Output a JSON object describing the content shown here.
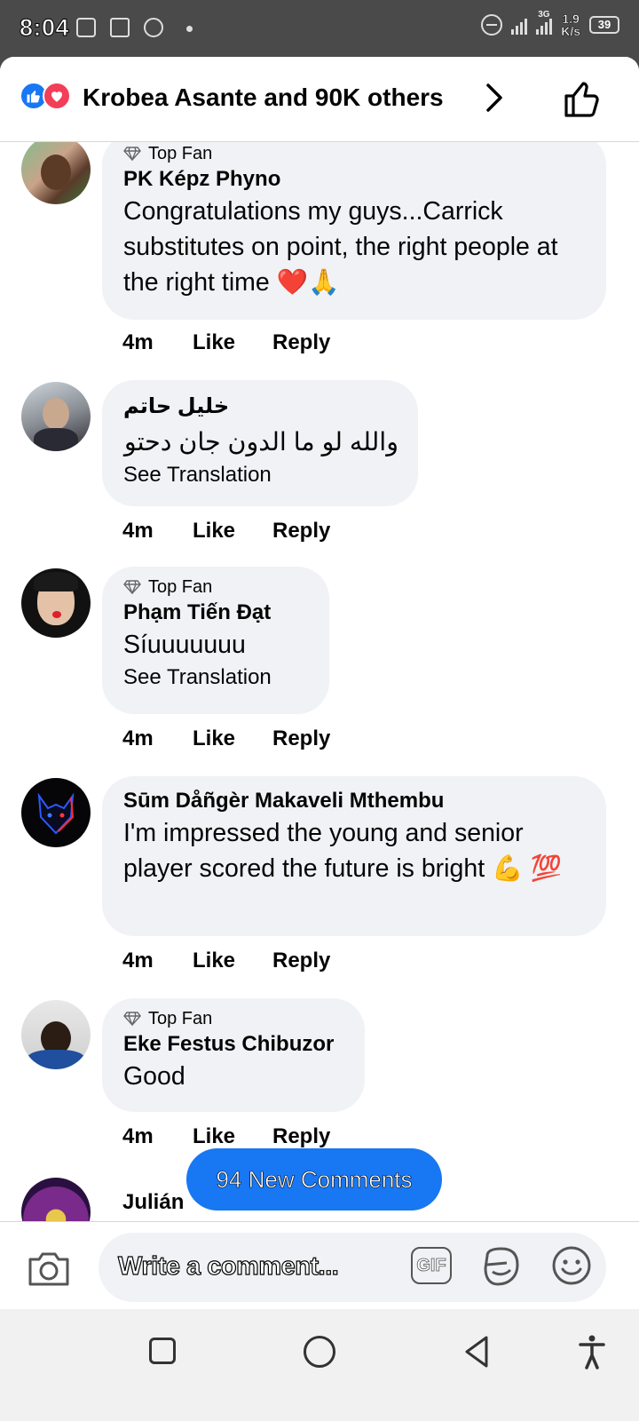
{
  "status_bar": {
    "time": "8:04",
    "network": "3G",
    "speed_value": "1.9",
    "speed_unit": "K/s",
    "battery": "39"
  },
  "header": {
    "reactions_text": "Krobea Asante and 90K others"
  },
  "comments": [
    {
      "badge": "Top Fan",
      "author": "PK Képz Phyno",
      "text": "Congratulations my guys...Carrick substitutes on point, the right people at the right time ❤️🙏",
      "time": "4m",
      "like": "Like",
      "reply": "Reply"
    },
    {
      "author": "خليل حاتم",
      "text": "والله لو ما الدون جان دحتو",
      "see_translation": "See Translation",
      "time": "4m",
      "like": "Like",
      "reply": "Reply"
    },
    {
      "badge": "Top Fan",
      "author": "Phạm Tiến Đạt",
      "text": "Síuuuuuuu",
      "see_translation": "See Translation",
      "time": "4m",
      "like": "Like",
      "reply": "Reply"
    },
    {
      "author": "Sūm Dåñgèr Makaveli Mthembu",
      "text": "I'm impressed the young and senior player scored the future is bright 💪 💯",
      "time": "4m",
      "like": "Like",
      "reply": "Reply"
    },
    {
      "badge": "Top Fan",
      "author": "Eke Festus Chibuzor",
      "text": "Good",
      "time": "4m",
      "like": "Like",
      "reply": "Reply"
    },
    {
      "author": "Julián"
    }
  ],
  "new_comments_pill": "94 New Comments",
  "composer": {
    "placeholder": "Write a comment...",
    "gif_label": "GIF"
  },
  "icons": {
    "like": "thumbs-up-icon",
    "love": "heart-icon",
    "camera": "camera-icon",
    "sticker": "sticker-icon",
    "emoji": "emoji-icon"
  },
  "colors": {
    "accent": "#1877f2",
    "love": "#f33e58",
    "bubble": "#f0f2f5",
    "status_bar": "#4a4a4a"
  }
}
